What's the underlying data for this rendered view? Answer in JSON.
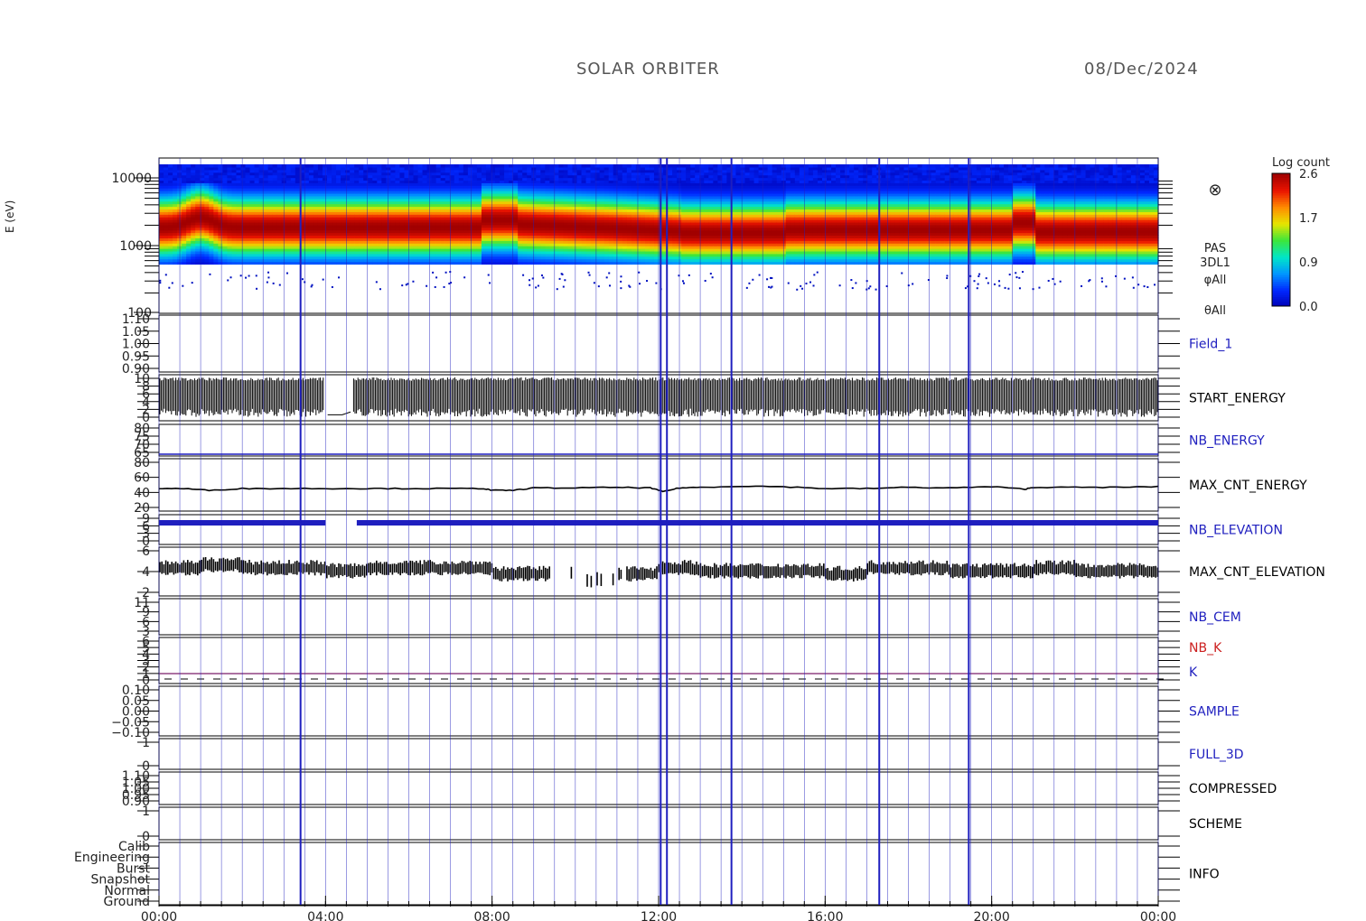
{
  "header": {
    "title": "SOLAR ORBITER",
    "date": "08/Dec/2024"
  },
  "colorbar": {
    "title": "Log count",
    "ticks": [
      "2.6",
      "1.7",
      "0.9",
      "0.0"
    ]
  },
  "spectrogram": {
    "ylabel": "E (eV)",
    "yticks": [
      "10000",
      "1000",
      "100"
    ],
    "labels": [
      "PAS",
      "3DL1",
      "φAll",
      "θAll"
    ],
    "symbol": "⊗"
  },
  "time_axis": {
    "ticks": [
      "00:00",
      "04:00",
      "08:00",
      "12:00",
      "16:00",
      "20:00",
      "00:00"
    ]
  },
  "colors": {
    "blue": "#1f1fbf",
    "red": "#cc2020",
    "black": "#000000",
    "purple": "#7a1f6a"
  },
  "chart_data": {
    "type": "line",
    "x_unit": "hours",
    "xlim": [
      0,
      24
    ],
    "panels": [
      {
        "name": "Field_1",
        "label_color": "blue",
        "yticks": [
          "1.10",
          "1.05",
          "1.00",
          "0.95",
          "0.90"
        ],
        "style": "empty"
      },
      {
        "name": "START_ENERGY",
        "label_color": "black",
        "yticks": [
          "10",
          "8",
          "6",
          "4",
          "2",
          "0"
        ],
        "style": "dense-spikes",
        "ylim": [
          0,
          10
        ],
        "gaps": [
          [
            3.95,
            4.65
          ]
        ],
        "values_range": [
          0,
          10
        ]
      },
      {
        "name": "NB_ENERGY",
        "label_color": "blue",
        "yticks": [
          "80",
          "75",
          "70",
          "65"
        ],
        "style": "flat",
        "value": 64
      },
      {
        "name": "MAX_CNT_ENERGY",
        "label_color": "black",
        "yticks": [
          "80",
          "60",
          "40",
          "20"
        ],
        "style": "line",
        "ylim": [
          10,
          90
        ],
        "x": [
          0,
          0.6,
          1.2,
          2,
          3,
          4,
          5,
          6,
          7,
          7.8,
          8,
          8.5,
          9,
          10,
          11,
          11.8,
          12.1,
          12.5,
          13,
          14,
          15,
          16,
          17,
          18,
          19,
          20,
          20.8,
          21,
          22,
          23,
          24
        ],
        "y": [
          44,
          44,
          41,
          44,
          44,
          44,
          44,
          44,
          44,
          44,
          41,
          41,
          45,
          45,
          46,
          45,
          39,
          45,
          46,
          48,
          47,
          44,
          44,
          46,
          45,
          47,
          43,
          46,
          46,
          46,
          47
        ]
      },
      {
        "name": "NB_ELEVATION",
        "label_color": "blue",
        "yticks": [
          "9",
          "6",
          "3",
          "0"
        ],
        "style": "band",
        "value": 9,
        "gaps": [
          [
            4.0,
            4.75
          ]
        ]
      },
      {
        "name": "MAX_CNT_ELEVATION",
        "label_color": "black",
        "yticks": [
          "6",
          "4",
          "2"
        ],
        "style": "blocky",
        "ylim": [
          0,
          7.5
        ],
        "x": [
          0,
          1,
          2,
          3,
          4,
          5,
          7.5,
          8,
          9,
          10,
          11,
          12,
          13,
          14,
          15,
          16,
          17,
          18,
          19,
          20,
          21,
          22,
          23,
          24
        ],
        "y": [
          4.5,
          5,
          4.5,
          4.5,
          4,
          4.5,
          4.5,
          3.5,
          3.5,
          2.5,
          3.5,
          4.5,
          4,
          4,
          4,
          3.5,
          4.5,
          4.5,
          4,
          4,
          4.5,
          4,
          4,
          4.5
        ]
      },
      {
        "name": "NB_CEM",
        "label_color": "blue",
        "yticks": [
          "11",
          "9",
          "6",
          "3"
        ],
        "style": "empty"
      },
      {
        "name": "NB_K",
        "label_color": "red",
        "yticks": [
          "6",
          "5",
          "4",
          "3",
          "2",
          "1",
          "0"
        ],
        "style": "k-line",
        "second_label": "K",
        "second_label_color": "blue"
      },
      {
        "name": "SAMPLE",
        "label_color": "blue",
        "yticks": [
          "0.10",
          "0.05",
          "0.00",
          "−0.05",
          "−0.10"
        ],
        "style": "empty"
      },
      {
        "name": "FULL_3D",
        "label_color": "blue",
        "yticks": [
          "1",
          "0"
        ],
        "style": "empty"
      },
      {
        "name": "COMPRESSED",
        "label_color": "black",
        "yticks": [
          "1.10",
          "1.05",
          "1.00",
          "0.95",
          "0.90"
        ],
        "style": "empty"
      },
      {
        "name": "SCHEME",
        "label_color": "black",
        "yticks": [
          "1",
          "0"
        ],
        "style": "empty"
      },
      {
        "name": "INFO",
        "label_color": "black",
        "yticks": [
          "Calib",
          "Engineering",
          "Burst",
          "Snapshot",
          "Normal",
          "Ground"
        ],
        "style": "empty"
      }
    ],
    "markers": {
      "color": "blue",
      "x_hours": [
        3.4,
        12.05,
        12.2,
        13.75,
        17.3,
        19.45
      ]
    }
  }
}
